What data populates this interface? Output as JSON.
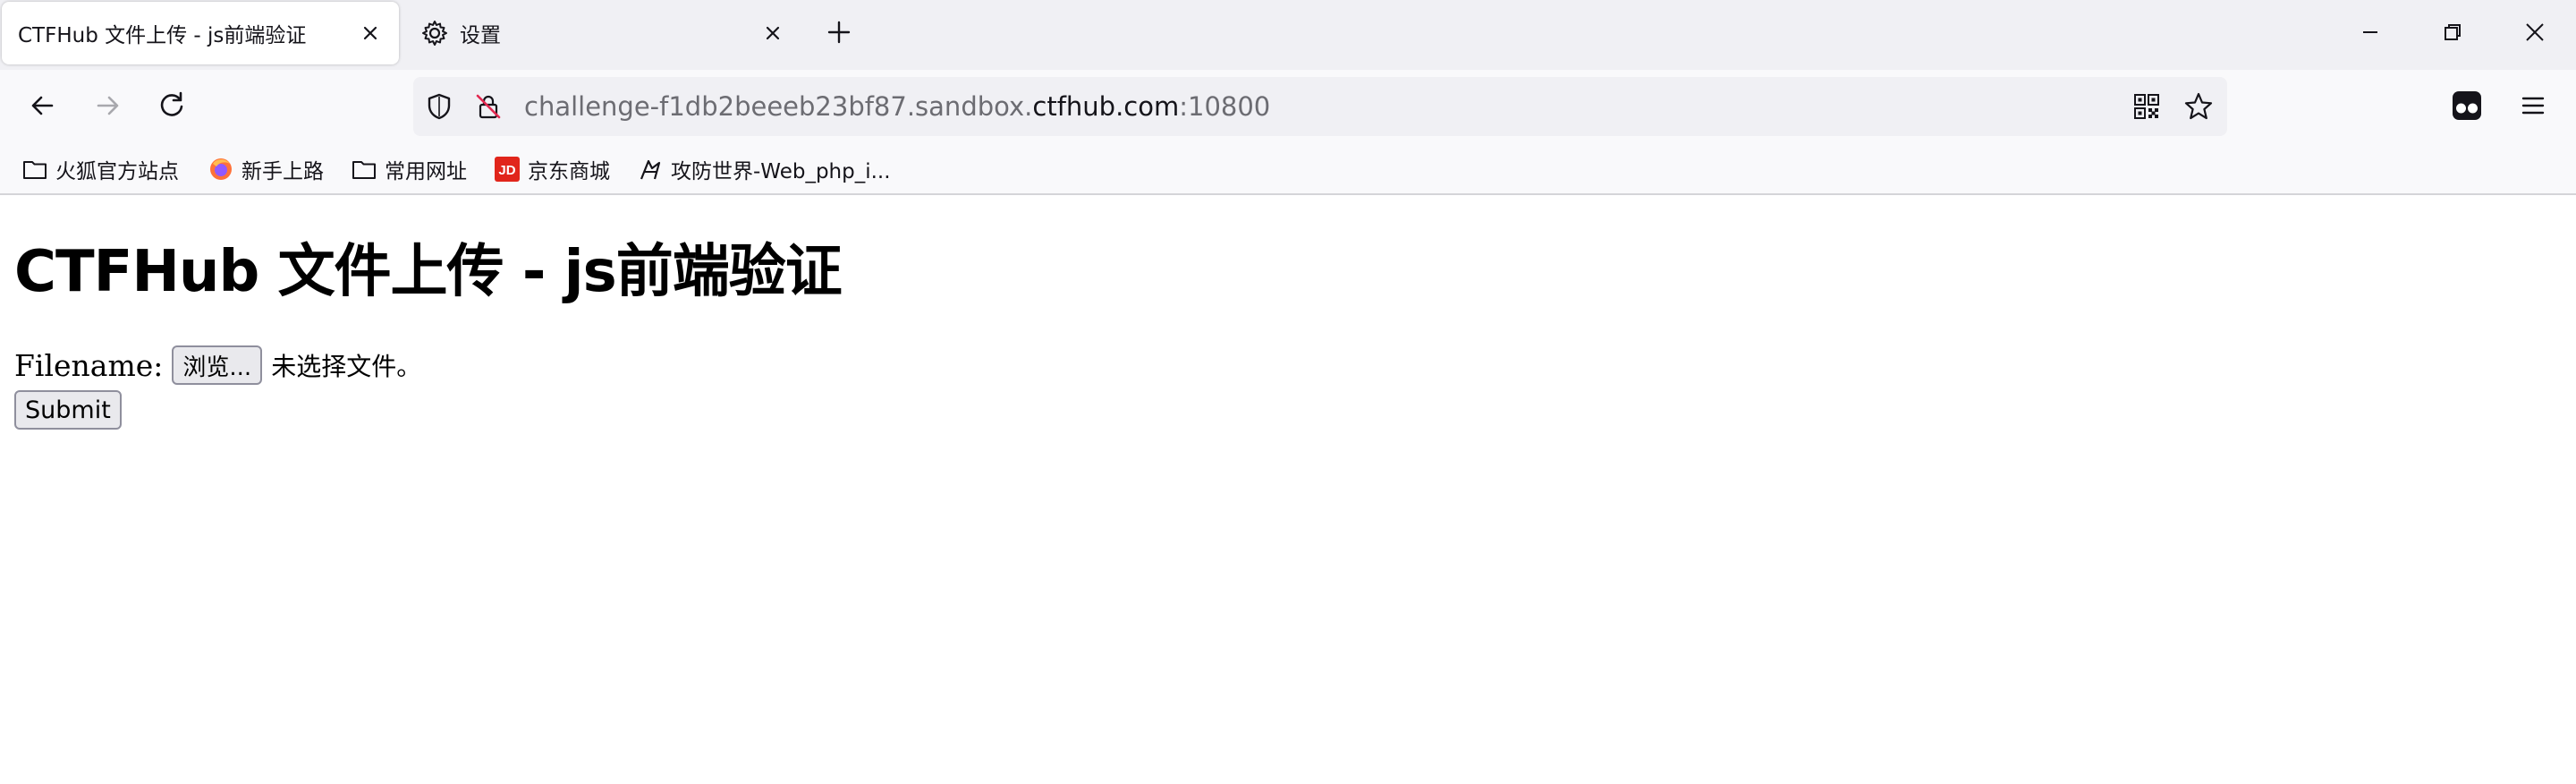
{
  "tabs": [
    {
      "title": "CTFHub 文件上传 - js前端验证",
      "active": true,
      "close_icon": "close-icon"
    },
    {
      "title": "设置",
      "active": false,
      "icon": "gear-icon",
      "close_icon": "close-icon"
    }
  ],
  "window_controls": [
    "minimize-icon",
    "restore-icon",
    "close-icon"
  ],
  "nav": {
    "url_prefix": "challenge-f1db2beeeb23bf87.sandbox.",
    "url_domain": "ctfhub.com",
    "url_port": ":10800"
  },
  "bookmarks": [
    {
      "label": "火狐官方站点",
      "icon": "folder-icon"
    },
    {
      "label": "新手上路",
      "icon": "firefox-icon"
    },
    {
      "label": "常用网址",
      "icon": "folder-icon"
    },
    {
      "label": "京东商城",
      "icon": "jd-icon"
    },
    {
      "label": "攻防世界-Web_php_i...",
      "icon": "xctf-icon"
    }
  ],
  "page": {
    "heading": "CTFHub 文件上传 - js前端验证",
    "filename_label": "Filename:",
    "browse_button": "浏览...",
    "no_file_text": "未选择文件。",
    "submit_button": "Submit"
  },
  "colors": {
    "tabstrip_bg": "#f0f0f4",
    "toolbar_bg": "#f9f9fb",
    "jd_red": "#e1251b",
    "text": "#15141a"
  }
}
